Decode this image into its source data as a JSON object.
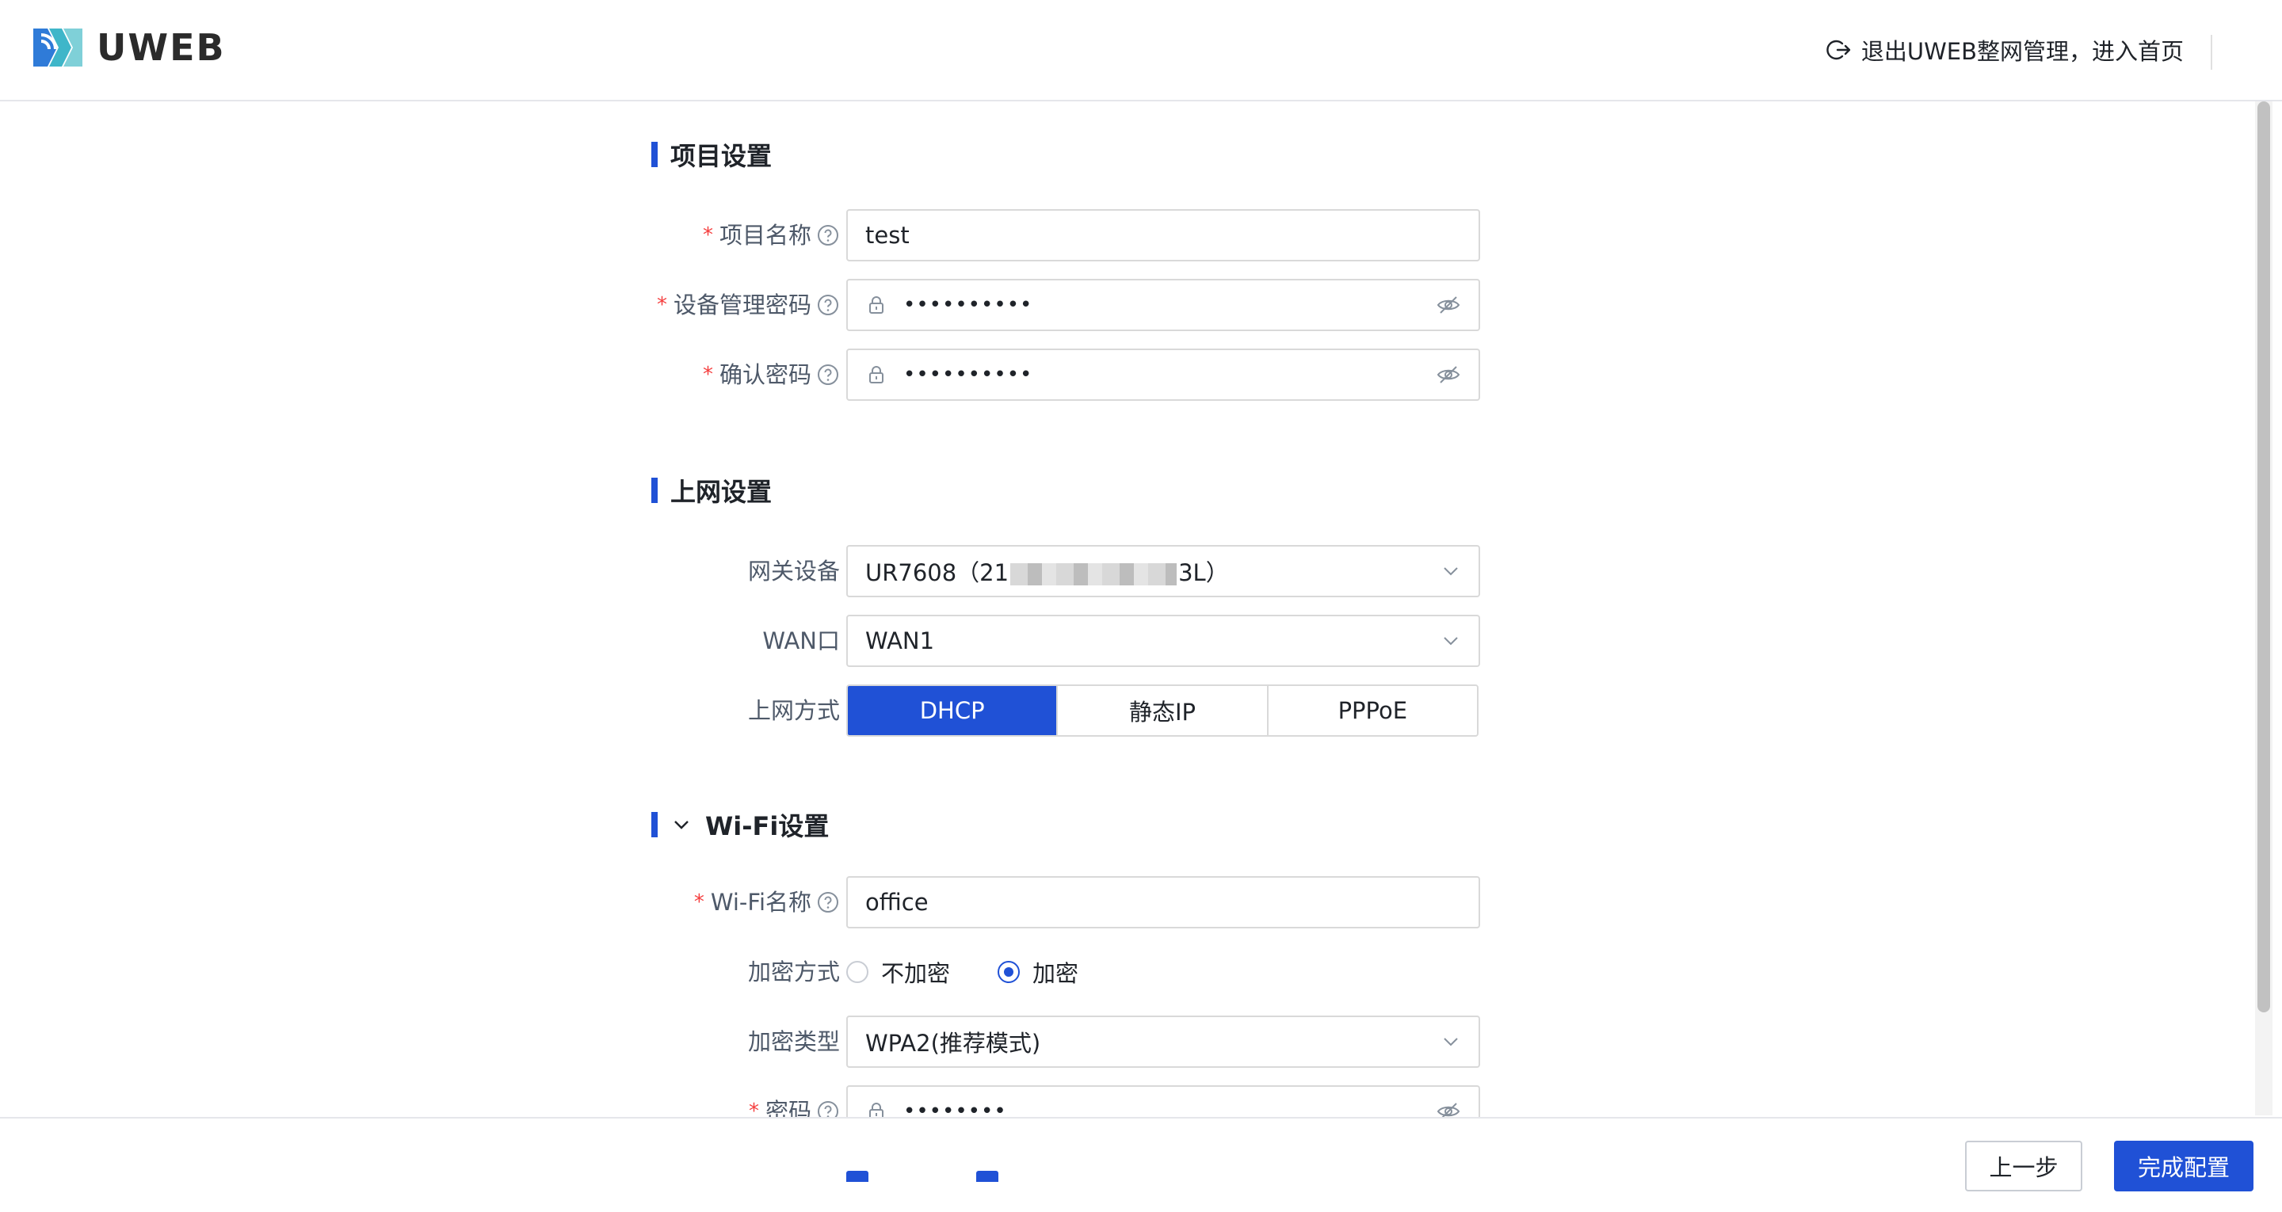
{
  "app": {
    "logo_text": "UWEB"
  },
  "header": {
    "exit_label": "退出UWEB整网管理，进入首页"
  },
  "project": {
    "title": "项目设置",
    "name_label": "项目名称",
    "name_value": "test",
    "admin_pwd_label": "设备管理密码",
    "admin_pwd_value": "••••••••••",
    "confirm_pwd_label": "确认密码",
    "confirm_pwd_value": "••••••••••"
  },
  "internet": {
    "title": "上网设置",
    "gateway_label": "网关设备",
    "gateway_value_prefix": "UR7608（21",
    "gateway_value_suffix": "3L）",
    "wan_label": "WAN口",
    "wan_value": "WAN1",
    "mode_label": "上网方式",
    "modes": [
      "DHCP",
      "静态IP",
      "PPPoE"
    ]
  },
  "wifi": {
    "title": "Wi-Fi设置",
    "name_label": "Wi-Fi名称",
    "name_value": "office",
    "enc_mode_label": "加密方式",
    "enc_options": [
      "不加密",
      "加密"
    ],
    "enc_type_label": "加密类型",
    "enc_type_value": "WPA2(推荐模式)",
    "pwd_label": "密码",
    "pwd_value": "••••••••"
  },
  "footer": {
    "prev_label": "上一步",
    "finish_label": "完成配置"
  },
  "colors": {
    "primary": "#2051d6",
    "required": "#f53f3f",
    "border": "#d9d9d9"
  }
}
